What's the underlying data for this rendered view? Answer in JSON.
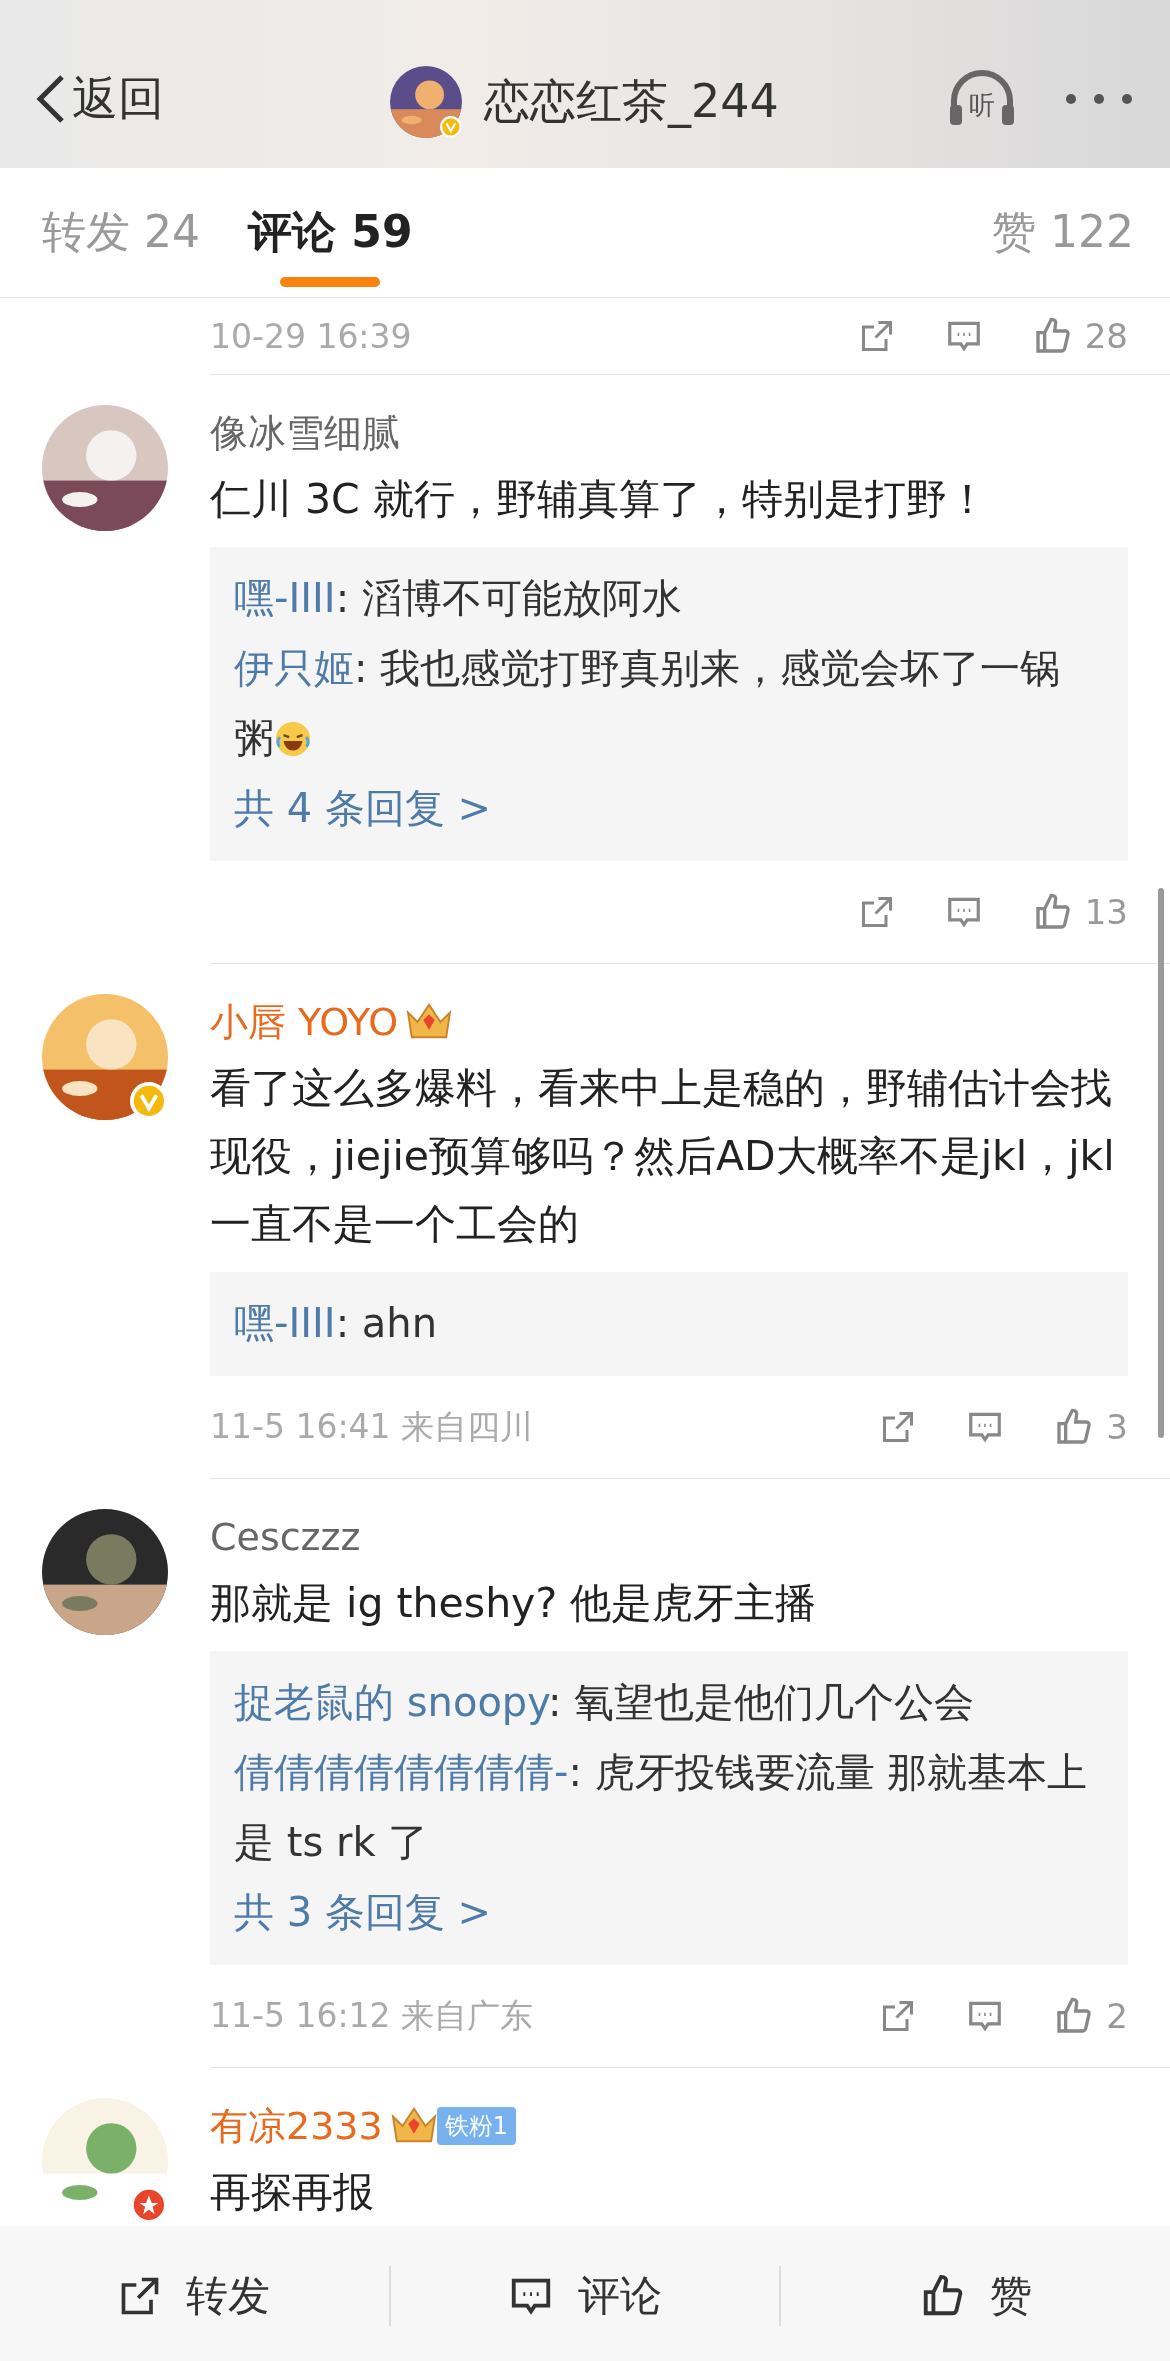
{
  "nav": {
    "back": "返回",
    "title": "恋恋红茶_244",
    "listen": "听"
  },
  "tabs": [
    {
      "label": "转发",
      "count": "24",
      "selected": false
    },
    {
      "label": "评论",
      "count": "59",
      "selected": true
    },
    {
      "label": "赞",
      "count": "122",
      "selected": false
    }
  ],
  "previous_actions": {
    "time": "10-29 16:39",
    "likes": "28"
  },
  "comments": [
    {
      "name": "像冰雪细腻",
      "member": false,
      "text": "仁川 3C 就行，野辅真算了，特别是打野！",
      "replies": [
        {
          "author": "嘿-IIII",
          "text": ": 滔博不可能放阿水"
        },
        {
          "author": "伊只姬",
          "text": ": 我也感觉打野真别来，感觉会坏了一锅粥",
          "emoji": true
        }
      ],
      "more": "共 4 条回复 >",
      "likes": "13"
    },
    {
      "name": "小唇 YOYO",
      "member": true,
      "crown": true,
      "verified": true,
      "text": "看了这么多爆料，看来中上是稳的，野辅估计会找现役，jiejie预算够吗？然后AD大概率不是jkl，jkl一直不是一个工会的",
      "replies": [
        {
          "author": "嘿-IIII",
          "text": ": ahn"
        }
      ],
      "time": "11-5 16:41 来自四川",
      "likes": "3"
    },
    {
      "name": "Cesczzz",
      "member": false,
      "text": "那就是 ig theshy?   他是虎牙主播",
      "replies": [
        {
          "author": "捉老鼠的 snoopy",
          "text": ": 氧望也是他们几个公会"
        },
        {
          "author": "倩倩倩倩倩倩倩倩-",
          "text": ": 虎牙投钱要流量 那就基本上是 ts rk 了"
        }
      ],
      "more": "共 3 条回复 >",
      "time": "11-5 16:12 来自广东",
      "likes": "2"
    },
    {
      "name": "有凉2333",
      "member": true,
      "crown": true,
      "fan_badge": "铁粉1",
      "star_badge": true,
      "text": "再探再报"
    }
  ],
  "bottom_bar": [
    {
      "kind": "share",
      "label": "转发"
    },
    {
      "kind": "comment",
      "label": "评论"
    },
    {
      "kind": "like",
      "label": "赞"
    }
  ]
}
